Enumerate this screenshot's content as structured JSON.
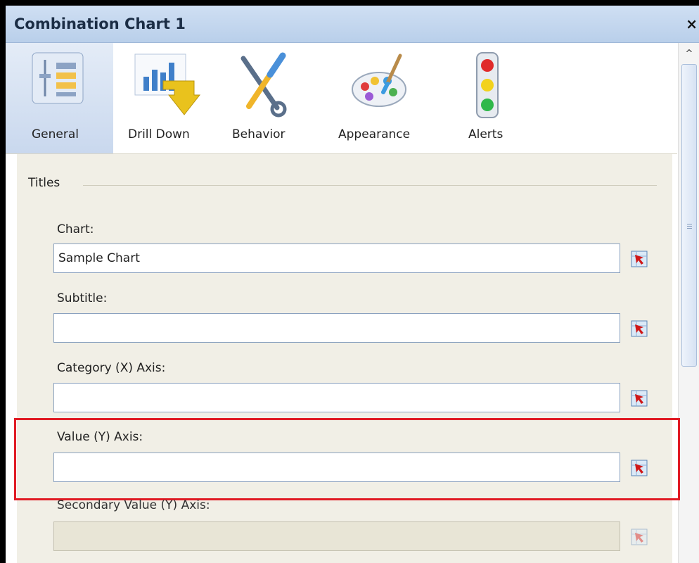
{
  "window": {
    "title": "Combination Chart 1",
    "close_glyph": "×"
  },
  "toolbar": {
    "tabs": [
      {
        "label": "General",
        "icon": "sliders-icon",
        "active": true
      },
      {
        "label": "Drill Down",
        "icon": "drill-down-icon",
        "active": false
      },
      {
        "label": "Behavior",
        "icon": "tools-icon",
        "active": false
      },
      {
        "label": "Appearance",
        "icon": "palette-icon",
        "active": false
      },
      {
        "label": "Alerts",
        "icon": "traffic-light-icon",
        "active": false
      }
    ]
  },
  "section": {
    "title": "Titles"
  },
  "fields": [
    {
      "label": "Chart:",
      "value": "Sample Chart",
      "enabled": true
    },
    {
      "label": "Subtitle:",
      "value": "",
      "enabled": true
    },
    {
      "label": "Category (X) Axis:",
      "value": "",
      "enabled": true
    },
    {
      "label": "Value (Y) Axis:",
      "value": "",
      "enabled": true
    },
    {
      "label": "Secondary Value (Y) Axis:",
      "value": "",
      "enabled": false
    }
  ],
  "scrollbar": {
    "up_glyph": "^"
  },
  "colors": {
    "highlight": "#e01b24",
    "panel": "#f1efe6",
    "active_tab": "#c9d8ee"
  }
}
